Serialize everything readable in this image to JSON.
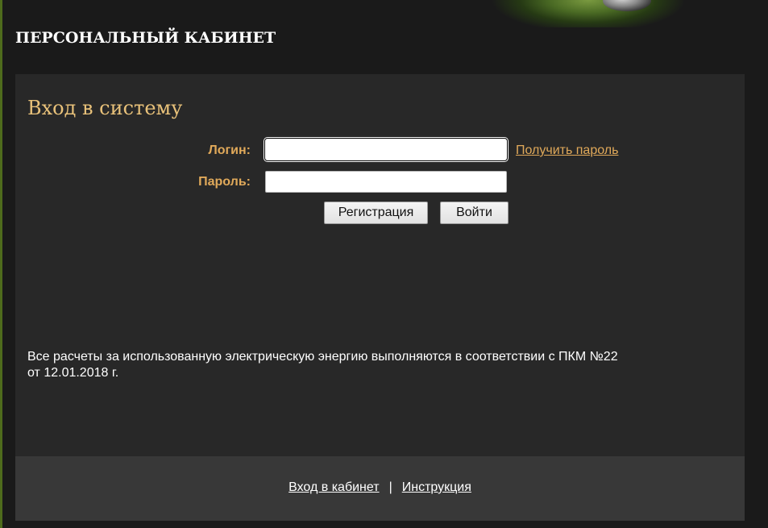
{
  "header": {
    "title": "ПЕРСОНАЛЬНЫЙ КАБИНЕТ"
  },
  "login_form": {
    "heading": "Вход в систему",
    "login_label": "Логин:",
    "login_value": "",
    "password_label": "Пароль:",
    "password_value": "",
    "get_password_link": "Получить пароль",
    "register_button": "Регистрация",
    "login_button": "Войти"
  },
  "notice": {
    "line1": "Все расчеты за использованную электрическую энергию выполняются в соответствии с ПКМ №22",
    "line2": "от 12.01.2018 г."
  },
  "footer": {
    "links": [
      "Вход в кабинет",
      "Инструкция"
    ],
    "separator": "|"
  },
  "colors": {
    "background": "#1a1a1a",
    "content_background": "#282828",
    "footer_background": "#383838",
    "accent": "#e0a95a",
    "heading": "#e9c27a"
  }
}
